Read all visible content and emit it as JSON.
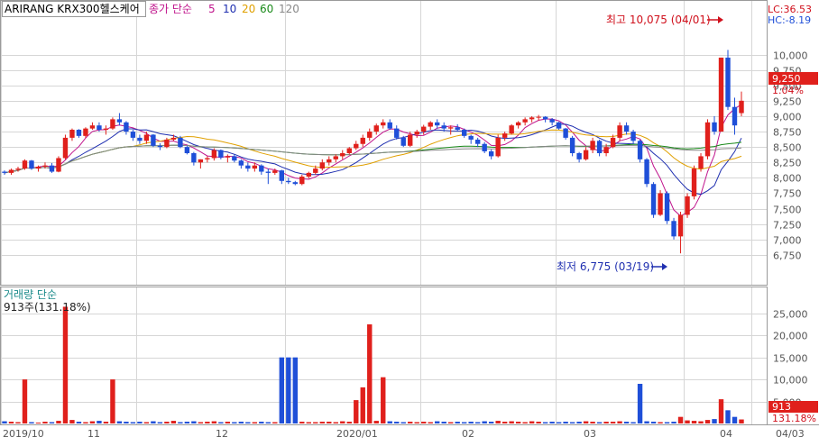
{
  "title": "ARIRANG KRX300헬스케어",
  "price_legend": {
    "label": "종가 단순",
    "periods": [
      {
        "label": "5",
        "color": "#c0148c"
      },
      {
        "label": "10",
        "color": "#1f2fb0"
      },
      {
        "label": "20",
        "color": "#e0a000"
      },
      {
        "label": "60",
        "color": "#1a8a1a"
      },
      {
        "label": "120",
        "color": "#888888"
      }
    ]
  },
  "volume_legend": {
    "label": "거래량 단순",
    "value_text": "913주(131.18%)"
  },
  "header_right": {
    "lc": "LC:36.53",
    "hc": "HC:-8.19"
  },
  "current_price": {
    "value": "9,250",
    "change": "1.04%"
  },
  "current_volume": {
    "value": "913",
    "ratio": "131.18%"
  },
  "annotations": {
    "high": {
      "text": "최고 10,075 (04/01)",
      "value": 10075
    },
    "low": {
      "text": "최저 6,775 (03/19)",
      "value": 6775
    }
  },
  "date_labels": [
    "2019/10",
    "11",
    "12",
    "2020/01",
    "02",
    "03",
    "04",
    "04/03"
  ],
  "colors": {
    "up": "#e0201c",
    "down": "#1f4fd8",
    "label_bg": "#e0201c",
    "annot": "#d0101c",
    "annot_low": "#1f2fb0"
  },
  "chart_data": {
    "type": "candlestick",
    "price_ylim": [
      6500,
      10300
    ],
    "price_ticks": [
      "6,750",
      "7,000",
      "7,250",
      "7,500",
      "7,750",
      "8,000",
      "8,250",
      "8,500",
      "8,750",
      "9,000",
      "9,250",
      "9,500",
      "9,750",
      "10,000"
    ],
    "volume_ylim": [
      0,
      27000
    ],
    "volume_ticks": [
      "5,000",
      "10,000",
      "15,000",
      "20,000",
      "25,000"
    ],
    "candles": [
      [
        8100,
        8120,
        8050,
        8080,
        500
      ],
      [
        8080,
        8150,
        8050,
        8130,
        400
      ],
      [
        8130,
        8180,
        8100,
        8150,
        300
      ],
      [
        8150,
        8300,
        8130,
        8280,
        10000
      ],
      [
        8280,
        8290,
        8130,
        8150,
        300
      ],
      [
        8150,
        8200,
        8100,
        8180,
        200
      ],
      [
        8180,
        8250,
        8150,
        8200,
        400
      ],
      [
        8200,
        8240,
        8080,
        8100,
        300
      ],
      [
        8100,
        8350,
        8090,
        8320,
        600
      ],
      [
        8320,
        8700,
        8300,
        8650,
        26500
      ],
      [
        8650,
        8800,
        8600,
        8780,
        800
      ],
      [
        8780,
        8790,
        8650,
        8680,
        400
      ],
      [
        8680,
        8820,
        8650,
        8800,
        300
      ],
      [
        8800,
        8900,
        8780,
        8850,
        500
      ],
      [
        8850,
        8900,
        8750,
        8780,
        600
      ],
      [
        8780,
        8850,
        8700,
        8800,
        400
      ],
      [
        8800,
        8980,
        8780,
        8950,
        10000
      ],
      [
        8950,
        9050,
        8850,
        8900,
        500
      ],
      [
        8900,
        8920,
        8700,
        8750,
        400
      ],
      [
        8750,
        8780,
        8600,
        8650,
        300
      ],
      [
        8650,
        8700,
        8550,
        8600,
        400
      ],
      [
        8600,
        8750,
        8550,
        8700,
        300
      ],
      [
        8700,
        8710,
        8500,
        8520,
        500
      ],
      [
        8520,
        8560,
        8450,
        8500,
        300
      ],
      [
        8500,
        8650,
        8480,
        8620,
        400
      ],
      [
        8620,
        8700,
        8600,
        8650,
        600
      ],
      [
        8650,
        8680,
        8480,
        8500,
        300
      ],
      [
        8500,
        8520,
        8380,
        8400,
        400
      ],
      [
        8400,
        8420,
        8200,
        8250,
        500
      ],
      [
        8250,
        8300,
        8150,
        8300,
        300
      ],
      [
        8300,
        8350,
        8250,
        8320,
        400
      ],
      [
        8320,
        8480,
        8280,
        8450,
        500
      ],
      [
        8450,
        8460,
        8300,
        8330,
        300
      ],
      [
        8330,
        8380,
        8250,
        8350,
        400
      ],
      [
        8350,
        8380,
        8250,
        8280,
        300
      ],
      [
        8280,
        8300,
        8150,
        8200,
        400
      ],
      [
        8200,
        8250,
        8100,
        8150,
        300
      ],
      [
        8150,
        8250,
        8100,
        8200,
        300
      ],
      [
        8200,
        8220,
        8050,
        8100,
        400
      ],
      [
        8100,
        8150,
        7900,
        8080,
        300
      ],
      [
        8080,
        8150,
        8050,
        8120,
        300
      ],
      [
        8120,
        8130,
        7900,
        7950,
        15000
      ],
      [
        7950,
        8000,
        7900,
        7930,
        15000
      ],
      [
        7930,
        7950,
        7880,
        7900,
        15000
      ],
      [
        7900,
        8050,
        7880,
        8020,
        400
      ],
      [
        8020,
        8100,
        7990,
        8080,
        300
      ],
      [
        8080,
        8200,
        8050,
        8150,
        300
      ],
      [
        8150,
        8300,
        8120,
        8250,
        400
      ],
      [
        8250,
        8350,
        8200,
        8300,
        400
      ],
      [
        8300,
        8380,
        8250,
        8350,
        300
      ],
      [
        8350,
        8450,
        8300,
        8400,
        500
      ],
      [
        8400,
        8500,
        8380,
        8480,
        400
      ],
      [
        8480,
        8600,
        8450,
        8550,
        5300
      ],
      [
        8550,
        8700,
        8500,
        8650,
        8200
      ],
      [
        8650,
        8800,
        8600,
        8750,
        22500
      ],
      [
        8750,
        8880,
        8700,
        8850,
        600
      ],
      [
        8850,
        8950,
        8800,
        8900,
        10500
      ],
      [
        8900,
        8950,
        8780,
        8800,
        500
      ],
      [
        8800,
        8850,
        8620,
        8650,
        400
      ],
      [
        8650,
        8680,
        8500,
        8520,
        300
      ],
      [
        8520,
        8750,
        8500,
        8700,
        400
      ],
      [
        8700,
        8780,
        8650,
        8750,
        300
      ],
      [
        8750,
        8860,
        8700,
        8830,
        400
      ],
      [
        8830,
        8920,
        8780,
        8900,
        300
      ],
      [
        8900,
        8950,
        8800,
        8850,
        500
      ],
      [
        8850,
        8900,
        8750,
        8800,
        400
      ],
      [
        8800,
        8850,
        8700,
        8820,
        300
      ],
      [
        8820,
        8870,
        8750,
        8780,
        400
      ],
      [
        8780,
        8800,
        8650,
        8680,
        300
      ],
      [
        8680,
        8700,
        8550,
        8620,
        400
      ],
      [
        8620,
        8650,
        8500,
        8550,
        300
      ],
      [
        8550,
        8580,
        8400,
        8430,
        500
      ],
      [
        8430,
        8460,
        8300,
        8350,
        400
      ],
      [
        8350,
        8700,
        8330,
        8650,
        600
      ],
      [
        8650,
        8750,
        8600,
        8720,
        400
      ],
      [
        8720,
        8870,
        8700,
        8850,
        500
      ],
      [
        8850,
        8920,
        8800,
        8900,
        400
      ],
      [
        8900,
        8980,
        8850,
        8950,
        300
      ],
      [
        8950,
        9000,
        8900,
        8980,
        500
      ],
      [
        8980,
        9020,
        8930,
        8990,
        400
      ],
      [
        8990,
        9000,
        8900,
        8950,
        300
      ],
      [
        8950,
        8970,
        8850,
        8900,
        400
      ],
      [
        8900,
        8910,
        8780,
        8800,
        300
      ],
      [
        8800,
        8810,
        8620,
        8650,
        400
      ],
      [
        8650,
        8680,
        8350,
        8400,
        300
      ],
      [
        8400,
        8420,
        8250,
        8300,
        400
      ],
      [
        8300,
        8500,
        8280,
        8450,
        500
      ],
      [
        8450,
        8650,
        8400,
        8600,
        400
      ],
      [
        8600,
        8620,
        8350,
        8400,
        300
      ],
      [
        8400,
        8550,
        8350,
        8500,
        400
      ],
      [
        8500,
        8700,
        8480,
        8650,
        400
      ],
      [
        8650,
        8900,
        8600,
        8850,
        500
      ],
      [
        8850,
        8900,
        8700,
        8750,
        400
      ],
      [
        8750,
        8780,
        8550,
        8600,
        300
      ],
      [
        8600,
        8620,
        8250,
        8300,
        9000
      ],
      [
        8300,
        8320,
        7850,
        7900,
        500
      ],
      [
        7900,
        7930,
        7350,
        7400,
        400
      ],
      [
        7400,
        7800,
        7380,
        7750,
        300
      ],
      [
        7750,
        7780,
        7250,
        7300,
        300
      ],
      [
        7300,
        7350,
        7000,
        7050,
        400
      ],
      [
        7050,
        7450,
        6775,
        7400,
        1500
      ],
      [
        7400,
        7750,
        7350,
        7700,
        700
      ],
      [
        7700,
        8200,
        7650,
        8150,
        600
      ],
      [
        8150,
        8400,
        8100,
        8350,
        500
      ],
      [
        8350,
        8950,
        8300,
        8900,
        800
      ],
      [
        8900,
        9000,
        8700,
        8750,
        1000
      ],
      [
        8750,
        9950,
        8750,
        9950,
        5500
      ],
      [
        9950,
        10075,
        9100,
        9150,
        3000
      ],
      [
        9150,
        9300,
        8700,
        8850,
        1500
      ],
      [
        9050,
        9400,
        9000,
        9250,
        913
      ]
    ]
  }
}
